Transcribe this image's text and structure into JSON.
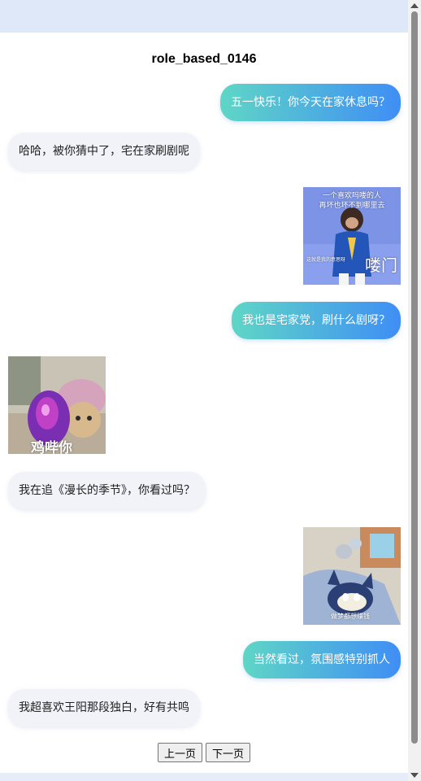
{
  "title": "role_based_0146",
  "messages": [
    {
      "side": "me",
      "text": "五一快乐！你今天在家休息吗？"
    },
    {
      "side": "other",
      "text": "哈哈，被你猜中了，宅在家刷剧呢"
    },
    {
      "side": "me",
      "sticker": {
        "name": "monkey-sticker",
        "caption_top_1": "一个喜欢吗喽的人",
        "caption_top_2": "再坏也坏不到哪里去",
        "caption_small": "这就是我的意思呀",
        "caption_big": "喽门"
      }
    },
    {
      "side": "me",
      "text": "我也是宅家党，刷什么剧呀？"
    },
    {
      "side": "other",
      "sticker": {
        "name": "kitten-sticker",
        "caption": "鸡哔你"
      }
    },
    {
      "side": "other",
      "text": "我在追《漫长的季节》，你看过吗？"
    },
    {
      "side": "me",
      "sticker": {
        "name": "tom-cat-sticker",
        "caption": "做梦都想赚钱"
      }
    },
    {
      "side": "me",
      "text": "当然看过，氛围感特别抓人"
    },
    {
      "side": "other",
      "text": "我超喜欢王阳那段独白，好有共鸣"
    }
  ],
  "pager": {
    "prev_label": "上一页",
    "next_label": "下一页"
  }
}
